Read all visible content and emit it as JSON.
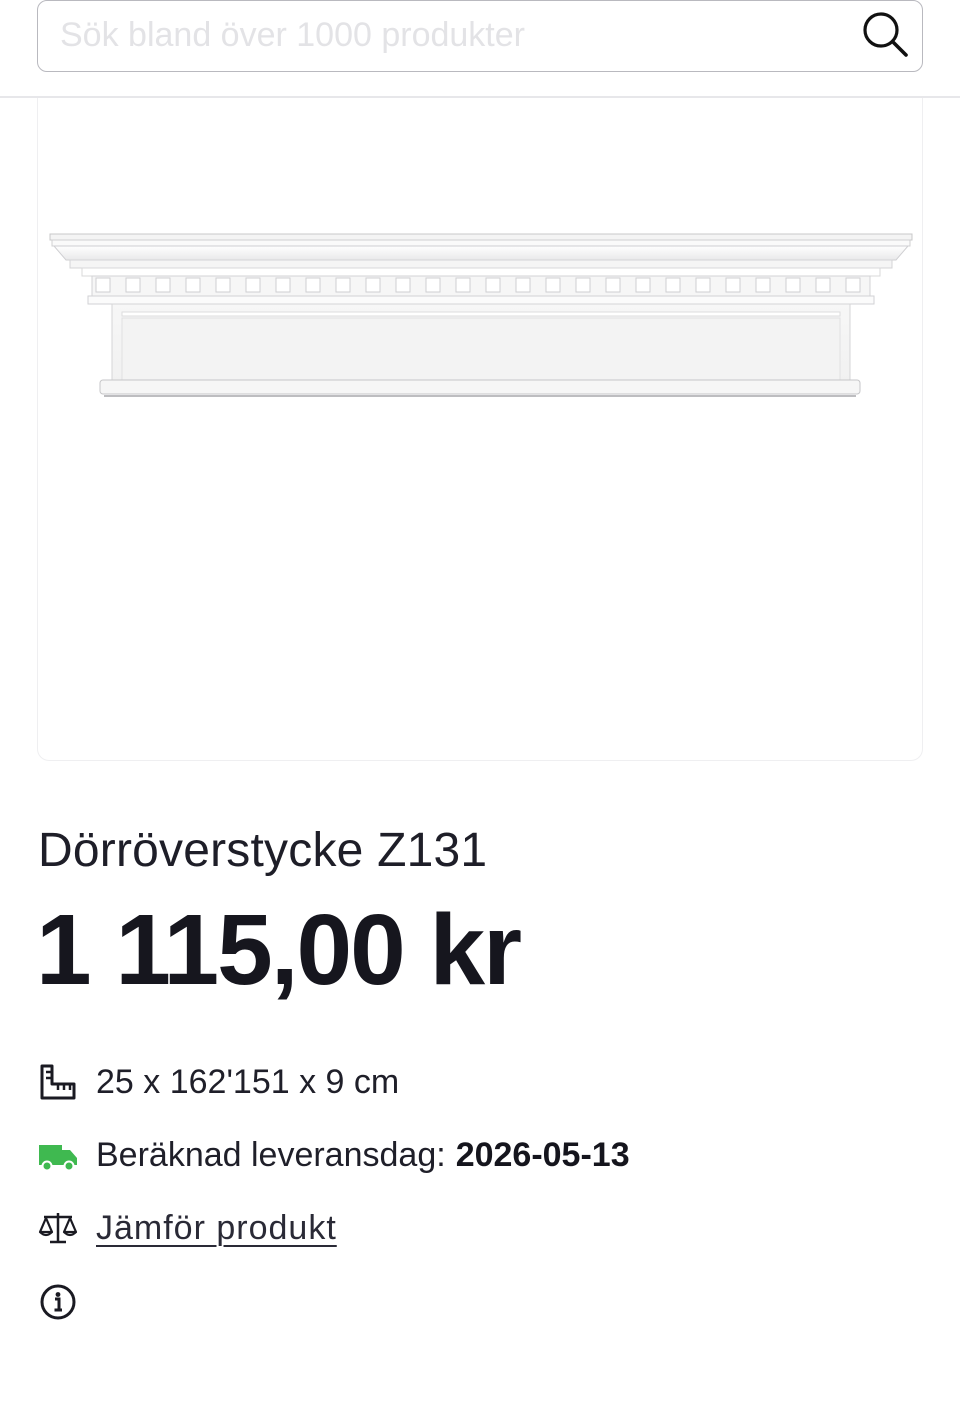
{
  "search": {
    "placeholder": "Sök bland över 1000 produkter",
    "icon": "search-icon"
  },
  "product": {
    "title": "Dörröverstycke Z131",
    "price": "1 115,00 kr",
    "image_icon": "door-pediment-image"
  },
  "info": {
    "dimensions": {
      "icon": "measure-icon",
      "text": "25 x 162'151 x 9 cm"
    },
    "delivery": {
      "icon": "truck-icon",
      "label": "Beräknad leveransdag:",
      "date": "2026-05-13",
      "icon_color": "#3fb950"
    },
    "compare": {
      "icon": "scale-icon",
      "label": "Jämför produkt"
    },
    "more_info": {
      "icon": "info-icon"
    }
  }
}
